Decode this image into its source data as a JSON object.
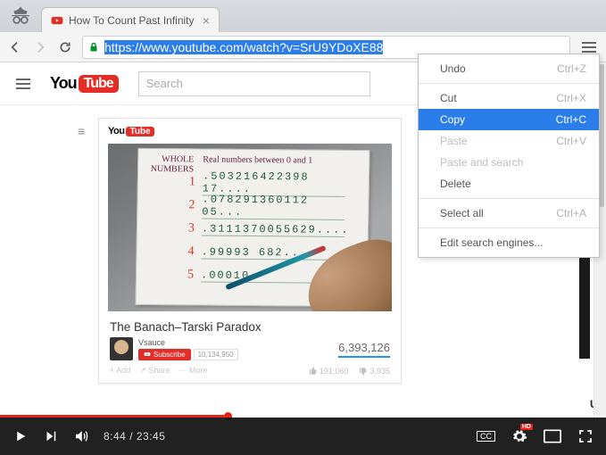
{
  "browser": {
    "tab_title": "How To Count Past Infinity",
    "tab_close_glyph": "×",
    "url_protocol": "https",
    "url_rest": "://www.youtube.com/watch?v=SrU9YDoXE88",
    "context_menu": {
      "undo": {
        "label": "Undo",
        "shortcut": "Ctrl+Z"
      },
      "cut": {
        "label": "Cut",
        "shortcut": "Ctrl+X"
      },
      "copy": {
        "label": "Copy",
        "shortcut": "Ctrl+C"
      },
      "paste": {
        "label": "Paste",
        "shortcut": "Ctrl+V"
      },
      "paste_search": {
        "label": "Paste and search",
        "shortcut": ""
      },
      "delete": {
        "label": "Delete",
        "shortcut": ""
      },
      "select_all": {
        "label": "Select all",
        "shortcut": "Ctrl+A"
      },
      "edit_engines": {
        "label": "Edit search engines...",
        "shortcut": ""
      }
    }
  },
  "youtube": {
    "logo_you": "You",
    "logo_tube": "Tube",
    "search_placeholder": "Search",
    "card": {
      "mini_you": "You",
      "mini_tube": "Tube",
      "paper": {
        "left_header": "WHOLE NUMBERS",
        "right_header": "Real numbers between 0 and 1",
        "rows": [
          {
            "n": "1",
            "v": ".503216422398 17...."
          },
          {
            "n": "2",
            "v": ".078291360112 05..."
          },
          {
            "n": "3",
            "v": ".3111370055629...."
          },
          {
            "n": "4",
            "v": ".99993     682..."
          },
          {
            "n": "5",
            "v": ".00010"
          }
        ]
      },
      "title": "The Banach–Tarski Paradox",
      "channel": "Vsauce",
      "subscribe": "Subscribe",
      "subscriber_count": "10,134,950",
      "views": "6,393,126",
      "add": "Add",
      "share": "Share",
      "more": "More",
      "likes": "191,060",
      "dislikes": "3,935",
      "up_next": "Up"
    }
  },
  "player": {
    "current_time": "8:44",
    "divider": " / ",
    "duration": "23:45",
    "cc": "CC",
    "hd": "HD"
  }
}
